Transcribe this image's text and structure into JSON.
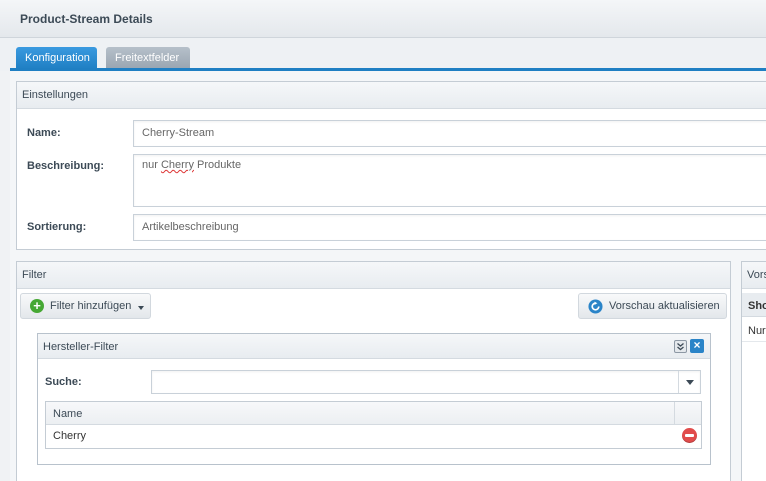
{
  "window": {
    "title": "Product-Stream Details"
  },
  "tabs": [
    {
      "label": "Konfiguration",
      "active": true
    },
    {
      "label": "Freitextfelder",
      "active": false
    }
  ],
  "settings": {
    "title": "Einstellungen",
    "name_label": "Name:",
    "name_value": "Cherry-Stream",
    "description_label": "Beschreibung:",
    "description_word1": "nur ",
    "description_word2": "Cherry",
    "description_word3": " Produkte",
    "sorting_label": "Sortierung:",
    "sorting_value": "Artikelbeschreibung"
  },
  "filter": {
    "title": "Filter",
    "add_button_label": "Filter hinzufügen",
    "refresh_button_label": "Vorschau aktualisieren",
    "manufacturer_filter": {
      "title": "Hersteller-Filter",
      "search_label": "Suche:",
      "search_value": "",
      "column_name": "Name",
      "rows": [
        {
          "name": "Cherry"
        }
      ]
    }
  },
  "preview": {
    "title": "Vors",
    "header_label": "Sho",
    "row_label": "Nur"
  },
  "colors": {
    "accent": "#1f7fc3",
    "add_green": "#46a834",
    "remove_red": "#e14c4c"
  }
}
